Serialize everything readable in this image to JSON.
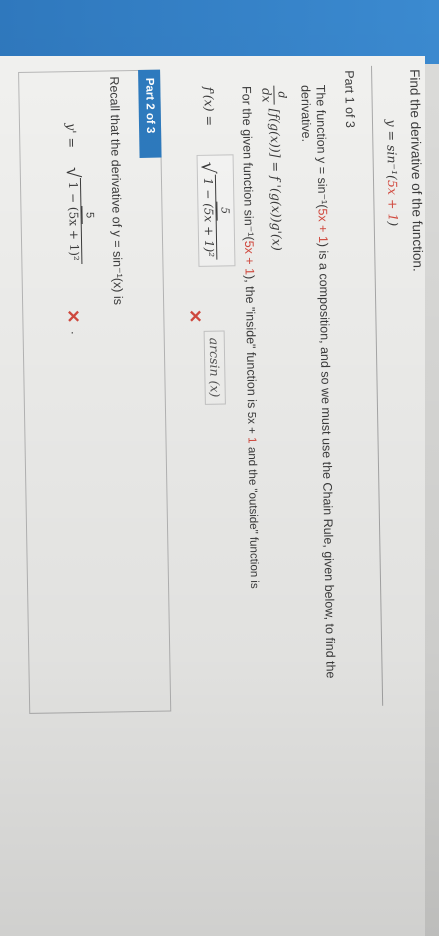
{
  "question": {
    "title": "Find the derivative of the function.",
    "function": "y = sin⁻¹(5x + 1)",
    "function_prefix": "y = sin⁻¹(",
    "function_inner": "5x + 1",
    "function_suffix": ")"
  },
  "part1": {
    "label": "Part 1 of 3",
    "text_a": "The function  y = sin⁻¹(",
    "text_inner": "5x + 1",
    "text_b": ")  is a composition, and so we must use the Chain Rule, given below, to find the",
    "text_c": "derivative.",
    "chain_rule_frac_num": "d",
    "chain_rule_frac_den": "dx",
    "chain_rule": "[f(g(x))] = f '(g(x))g'(x)",
    "given_a": "For the given function  sin⁻¹(",
    "given_inner": "5x + 1",
    "given_b": "),  the \"inside\" function is",
    "inside_fn_a": "5x + ",
    "inside_fn_b": "1",
    "given_c": "and the \"outside\" function is",
    "fprime_label": "f'(x) =",
    "fprime_num": "5",
    "fprime_den": "1 − (5x + 1)²",
    "outside_fn": "arcsin (x)",
    "mark": "✕"
  },
  "part2": {
    "label": "Part 2 of 3",
    "text_a": "Recall that the derivative of  y = sin⁻¹(x)  is",
    "yprime_label": "y' =",
    "yprime_num": "5",
    "yprime_den": "1 − (5x + 1)²",
    "mark": "✕",
    "trailing": "."
  },
  "colors": {
    "accent": "#2e7bbf",
    "error": "#d54a3f",
    "paper": "#f2f2f0"
  }
}
